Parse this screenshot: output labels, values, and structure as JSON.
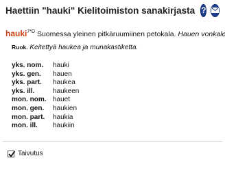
{
  "header": {
    "title": "Haettiin \"hauki\" Kielitoimiston sanakirjasta",
    "help_glyph": "?",
    "icons": [
      "help-icon",
      "mail-icon"
    ]
  },
  "entry": {
    "headword": "hauki",
    "inflection_code": "7*D",
    "definition": " Suomessa yleinen pitkäruumiinen petokala. ",
    "example_italic": "Hauen vonkale.",
    "example_abbr": "Ruok.",
    "example2": "Keitettyä haukea ja munakastiketta."
  },
  "forms": [
    {
      "label": "yks. nom.",
      "value": "hauki"
    },
    {
      "label": "yks. gen.",
      "value": "hauen"
    },
    {
      "label": "yks. part.",
      "value": "haukea"
    },
    {
      "label": "yks. ill.",
      "value": "haukeen"
    },
    {
      "label": "mon. nom.",
      "value": "hauet"
    },
    {
      "label": "mon. gen.",
      "value": "haukien"
    },
    {
      "label": "mon. part.",
      "value": "haukia"
    },
    {
      "label": "mon. ill.",
      "value": "haukiin"
    }
  ],
  "footer": {
    "checkbox_label": "Taivutus",
    "checkbox_checked": true
  },
  "colors": {
    "headword": "#d0401a",
    "icon_bg": "#1f3f8f"
  }
}
